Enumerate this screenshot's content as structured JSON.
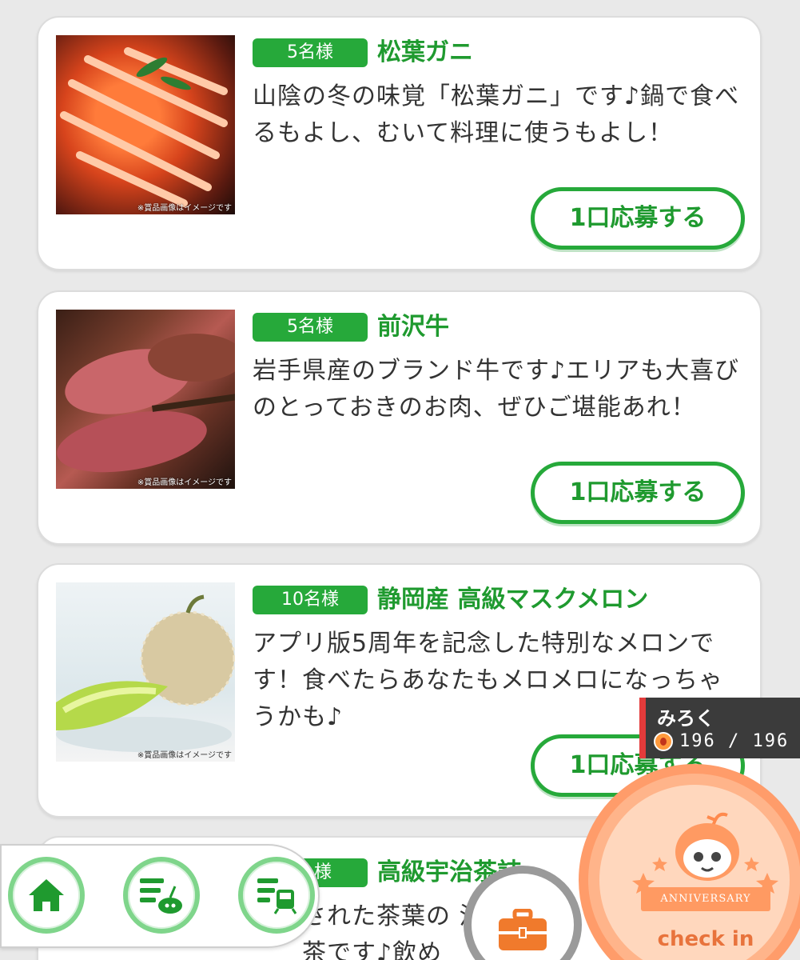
{
  "prizes": [
    {
      "qty": "5名様",
      "title": "松葉ガニ",
      "desc": "山陰の冬の味覚「松葉ガニ」です♪鍋で食べるもよし、むいて料理に使うもよし！",
      "image_note": "※賞品画像はイメージです",
      "button": "1口応募する"
    },
    {
      "qty": "5名様",
      "title": "前沢牛",
      "desc": "岩手県産のブランド牛です♪エリアも大喜びのとっておきのお肉、ぜひご堪能あれ！",
      "image_note": "※賞品画像はイメージです",
      "button": "1口応募する"
    },
    {
      "qty": "10名様",
      "title": "静岡産 高級マスクメロン",
      "desc": "アプリ版5周年を記念した特別なメロンです！食べたらあなたもメロメロになっちゃうかも♪",
      "image_note": "※賞品画像はイメージです",
      "button": "1口応募する"
    },
    {
      "qty": "様",
      "title": "高級宇治茶詰",
      "desc": "された茶葉の 治茶です♪飲め"
    }
  ],
  "user": {
    "name": "みろく",
    "hp": "196 / 196"
  },
  "checkin": {
    "ribbon": "ANNIVERSARY",
    "label": "check in"
  },
  "nav": {
    "items": [
      "home-icon",
      "quest-list-icon",
      "train-list-icon"
    ]
  },
  "colors": {
    "accent_green": "#26a93a",
    "user_bar_red": "#e33b3b",
    "checkin_orange": "#ff9c6a"
  }
}
